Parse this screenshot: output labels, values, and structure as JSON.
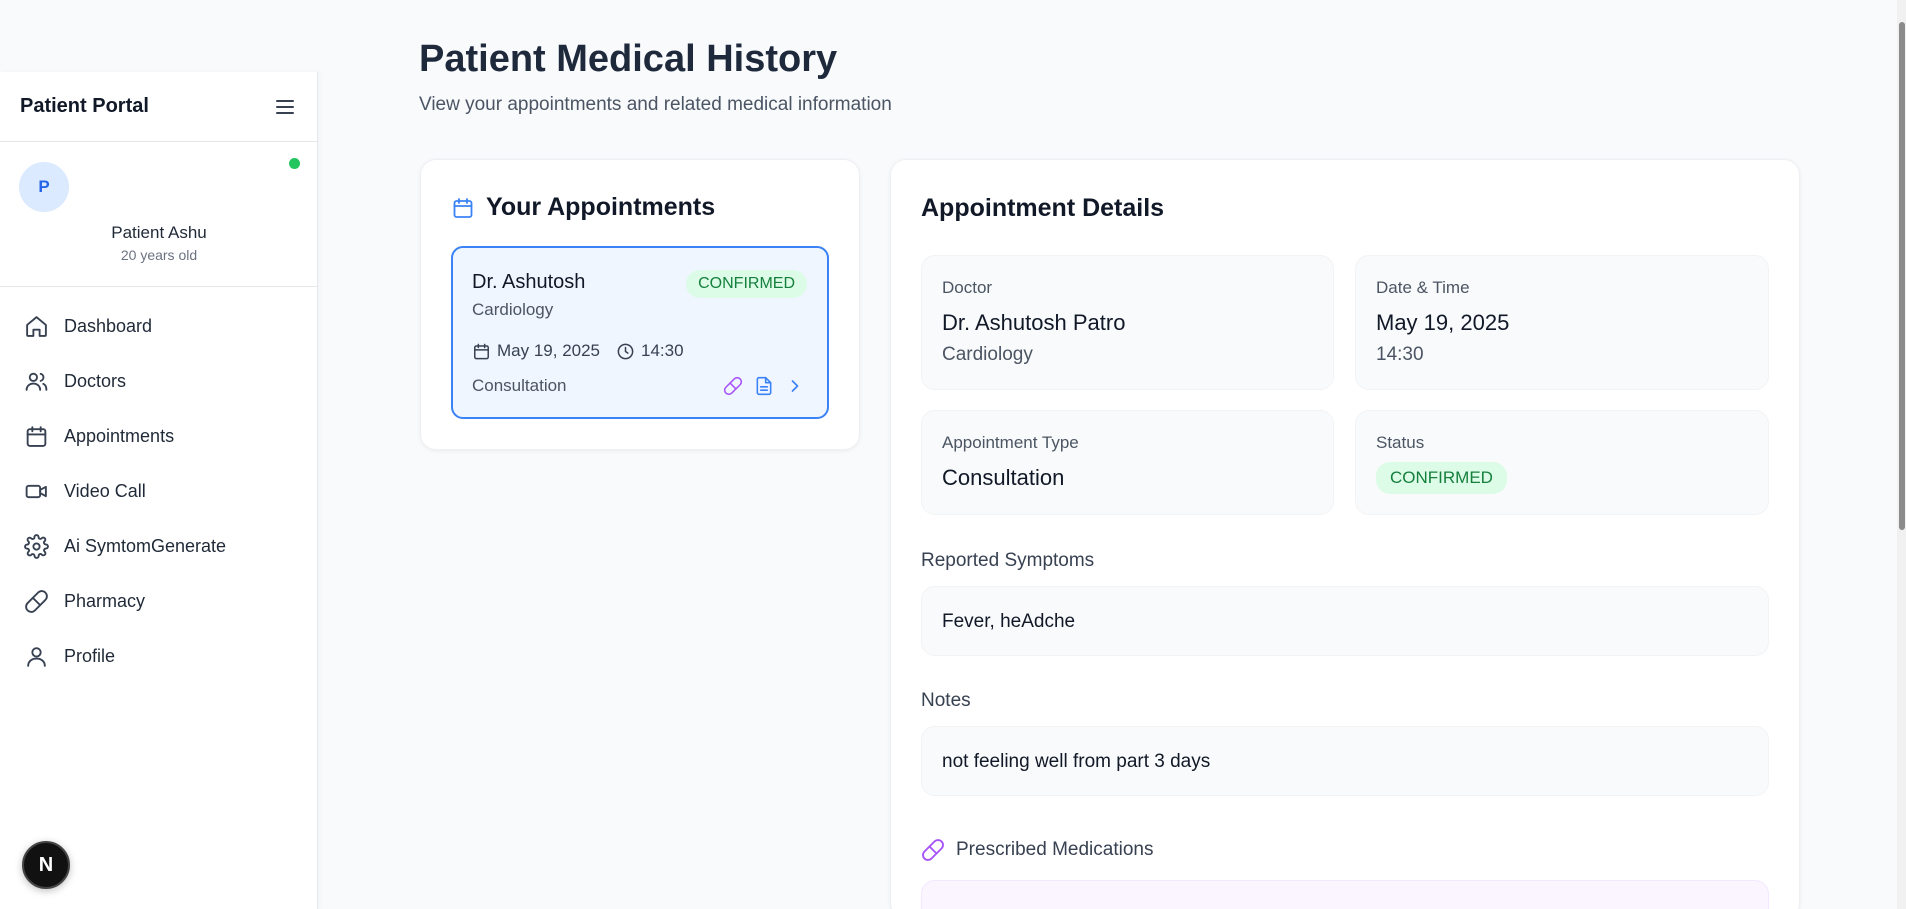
{
  "sidebar": {
    "title": "Patient Portal",
    "user": {
      "initial": "P",
      "name": "Patient Ashu",
      "age": "20 years old",
      "online_color": "#22c55e"
    },
    "items": [
      {
        "label": "Dashboard",
        "icon": "home-icon"
      },
      {
        "label": "Doctors",
        "icon": "users-icon"
      },
      {
        "label": "Appointments",
        "icon": "calendar-icon"
      },
      {
        "label": "Video Call",
        "icon": "video-icon"
      },
      {
        "label": "Ai SymtomGenerate",
        "icon": "gear-icon"
      },
      {
        "label": "Pharmacy",
        "icon": "pill-icon"
      },
      {
        "label": "Profile",
        "icon": "user-icon"
      }
    ]
  },
  "header": {
    "title": "Patient Medical History",
    "subtitle": "View your appointments and related medical information"
  },
  "appointments": {
    "title": "Your Appointments",
    "items": [
      {
        "doctor": "Dr. Ashutosh",
        "specialty": "Cardiology",
        "status": "CONFIRMED",
        "date": "May 19, 2025",
        "time": "14:30",
        "type": "Consultation"
      }
    ]
  },
  "details": {
    "title": "Appointment Details",
    "doctor_label": "Doctor",
    "doctor_name": "Dr. Ashutosh Patro",
    "doctor_specialty": "Cardiology",
    "datetime_label": "Date & Time",
    "date": "May 19, 2025",
    "time": "14:30",
    "type_label": "Appointment Type",
    "type": "Consultation",
    "status_label": "Status",
    "status": "CONFIRMED",
    "symptoms_label": "Reported Symptoms",
    "symptoms": "Fever, heAdche",
    "notes_label": "Notes",
    "notes": "not feeling well from part 3 days",
    "medications_label": "Prescribed Medications"
  },
  "colors": {
    "accent": "#3b82f6",
    "status_bg": "#dcfce7",
    "status_text": "#15803d",
    "medication": "#a855f7"
  },
  "floating_badge": {
    "label": "N"
  }
}
